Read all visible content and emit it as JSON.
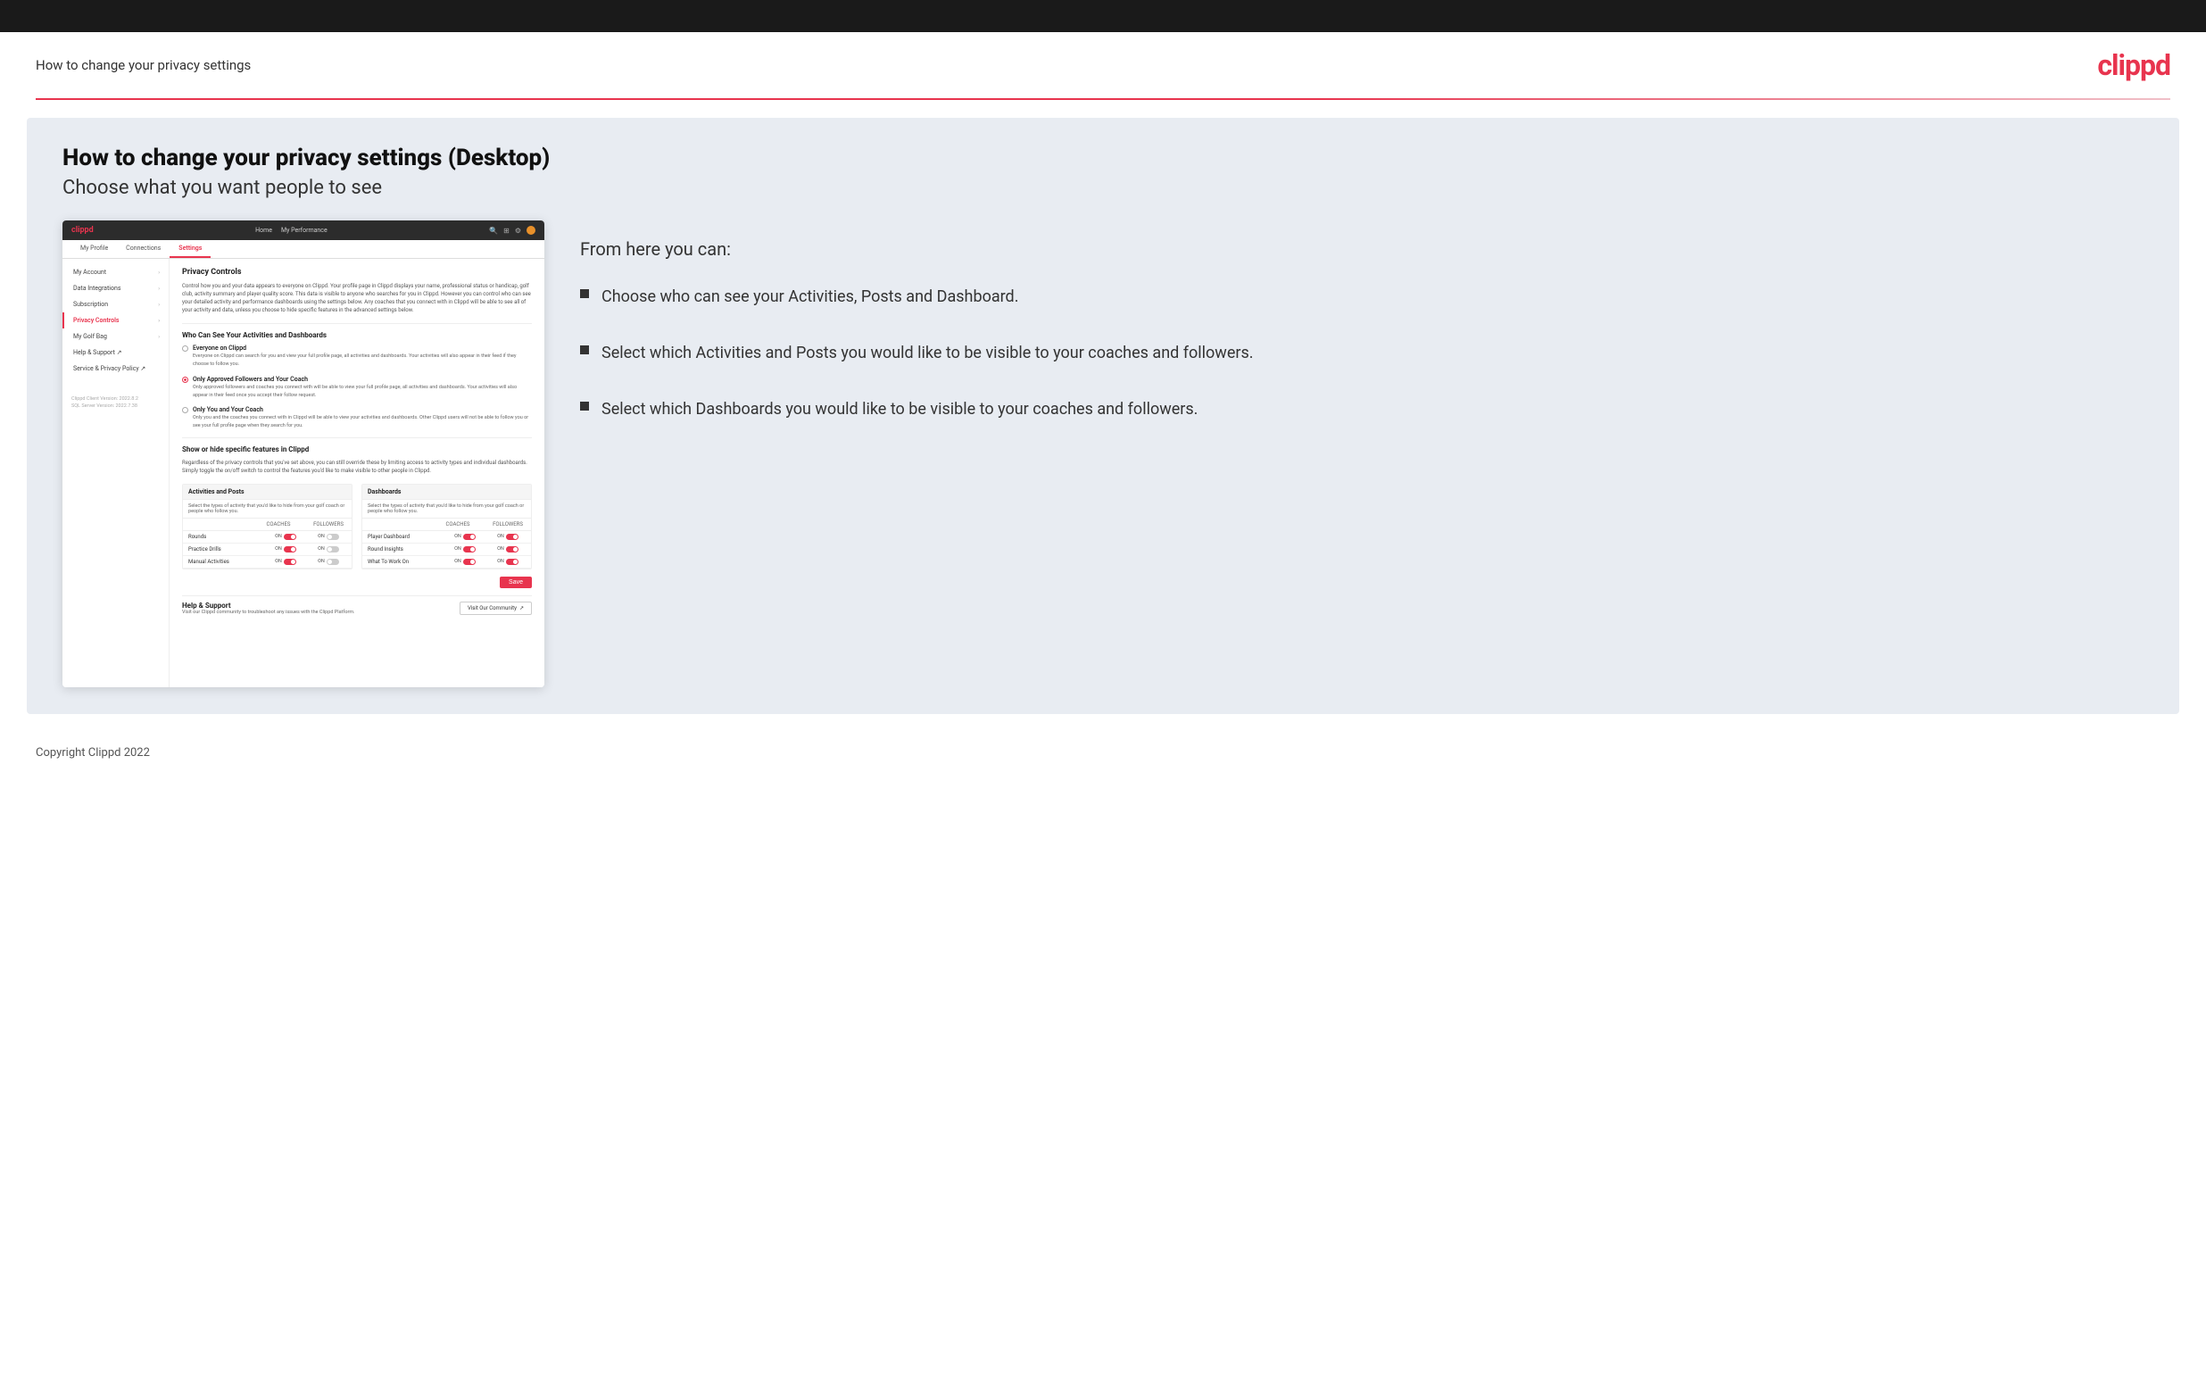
{
  "topbar": {},
  "header": {
    "title": "How to change your privacy settings",
    "logo": "clippd"
  },
  "main": {
    "heading": "How to change your privacy settings (Desktop)",
    "subheading": "Choose what you want people to see",
    "right_panel": {
      "intro": "From here you can:",
      "bullets": [
        "Choose who can see your Activities, Posts and Dashboard.",
        "Select which Activities and Posts you would like to be visible to your coaches and followers.",
        "Select which Dashboards you would like to be visible to your coaches and followers."
      ]
    }
  },
  "mockup": {
    "logo": "clippd",
    "nav": {
      "links": [
        "Home",
        "My Performance"
      ],
      "subnav": [
        "My Profile",
        "Connections",
        "Settings"
      ]
    },
    "sidebar": {
      "items": [
        {
          "label": "My Account",
          "active": false
        },
        {
          "label": "Data Integrations",
          "active": false
        },
        {
          "label": "Subscription",
          "active": false
        },
        {
          "label": "Privacy Controls",
          "active": true
        },
        {
          "label": "My Golf Bag",
          "active": false
        },
        {
          "label": "Help & Support",
          "active": false
        },
        {
          "label": "Service & Privacy Policy",
          "active": false
        }
      ],
      "version": "Clippd Client Version: 2022.8.2\nSQL Server Version: 2022.7.38"
    },
    "main": {
      "section_title": "Privacy Controls",
      "section_desc": "Control how you and your data appears to everyone on Clippd. Your profile page in Clippd displays your name, professional status or handicap, golf club, activity summary and player quality score. This data is visible to anyone who searches for you in Clippd. However you can control who can see your detailed activity and performance dashboards using the settings below. Any coaches that you connect with in Clippd will be able to see all of your activity and data, unless you choose to hide specific features in the advanced settings below.",
      "who_section_title": "Who Can See Your Activities and Dashboards",
      "radio_options": [
        {
          "label": "Everyone on Clippd",
          "desc": "Everyone on Clippd can search for you and view your full profile page, all activities and dashboards. Your activities will also appear in their feed if they choose to follow you.",
          "selected": false
        },
        {
          "label": "Only Approved Followers and Your Coach",
          "desc": "Only approved followers and coaches you connect with will be able to view your full profile page, all activities and dashboards. Your activities will also appear in their feed once you accept their follow request.",
          "selected": true
        },
        {
          "label": "Only You and Your Coach",
          "desc": "Only you and the coaches you connect with in Clippd will be able to view your activities and dashboards. Other Clippd users will not be able to follow you or see your full profile page when they search for you.",
          "selected": false
        }
      ],
      "show_hide_title": "Show or hide specific features in Clippd",
      "show_hide_desc": "Regardless of the privacy controls that you've set above, you can still override these by limiting access to activity types and individual dashboards. Simply toggle the on/off switch to control the features you'd like to make visible to other people in Clippd.",
      "activities_posts": {
        "title": "Activities and Posts",
        "desc": "Select the types of activity that you'd like to hide from your golf coach or people who follow you.",
        "cols": [
          "COACHES",
          "FOLLOWERS"
        ],
        "rows": [
          {
            "label": "Rounds",
            "coaches_on": true,
            "followers_on": false
          },
          {
            "label": "Practice Drills",
            "coaches_on": true,
            "followers_on": false
          },
          {
            "label": "Manual Activities",
            "coaches_on": true,
            "followers_on": false
          }
        ]
      },
      "dashboards": {
        "title": "Dashboards",
        "desc": "Select the types of activity that you'd like to hide from your golf coach or people who follow you.",
        "cols": [
          "COACHES",
          "FOLLOWERS"
        ],
        "rows": [
          {
            "label": "Player Dashboard",
            "coaches_on": true,
            "followers_on": true
          },
          {
            "label": "Round Insights",
            "coaches_on": true,
            "followers_on": true
          },
          {
            "label": "What To Work On",
            "coaches_on": true,
            "followers_on": true
          }
        ]
      },
      "save_label": "Save",
      "help": {
        "title": "Help & Support",
        "desc": "Visit our Clippd community to troubleshoot any issues with the Clippd Platform.",
        "button_label": "Visit Our Community"
      }
    }
  },
  "footer": {
    "text": "Copyright Clippd 2022"
  }
}
